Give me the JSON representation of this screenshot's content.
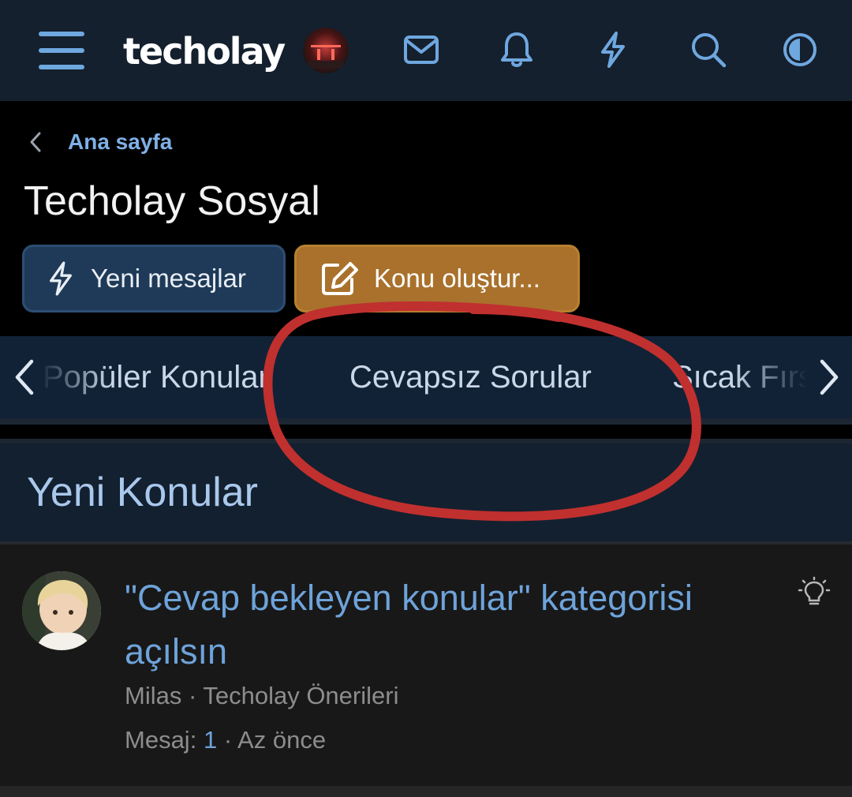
{
  "header": {
    "logo": "techolay",
    "icons": [
      "menu-icon",
      "mail-icon",
      "bell-icon",
      "bolt-icon",
      "search-icon",
      "contrast-icon"
    ]
  },
  "breadcrumb": {
    "label": "Ana sayfa"
  },
  "page": {
    "title": "Techolay Sosyal"
  },
  "buttons": {
    "new_messages": "Yeni mesajlar",
    "create_topic": "Konu oluştur..."
  },
  "tabs": [
    {
      "label": "Popüler Konular"
    },
    {
      "label": "Cevapsız Sorular"
    },
    {
      "label": "Sıcak Fırsatlar"
    }
  ],
  "section": {
    "title": "Yeni Konular"
  },
  "thread": {
    "title": "\"Cevap bekleyen konular\" kategorisi açılsın",
    "author": "Milas",
    "dot": "·",
    "forum": "Techolay Önerileri",
    "replies_label": "Mesaj:",
    "replies": "1",
    "time": "Az önce",
    "icon": "lightbulb-icon"
  },
  "colors": {
    "topbar": "#14202e",
    "link": "#6ea3da",
    "create_button": "#a9712c",
    "new_button": "#1f3a58",
    "annotation": "#c0302f"
  }
}
